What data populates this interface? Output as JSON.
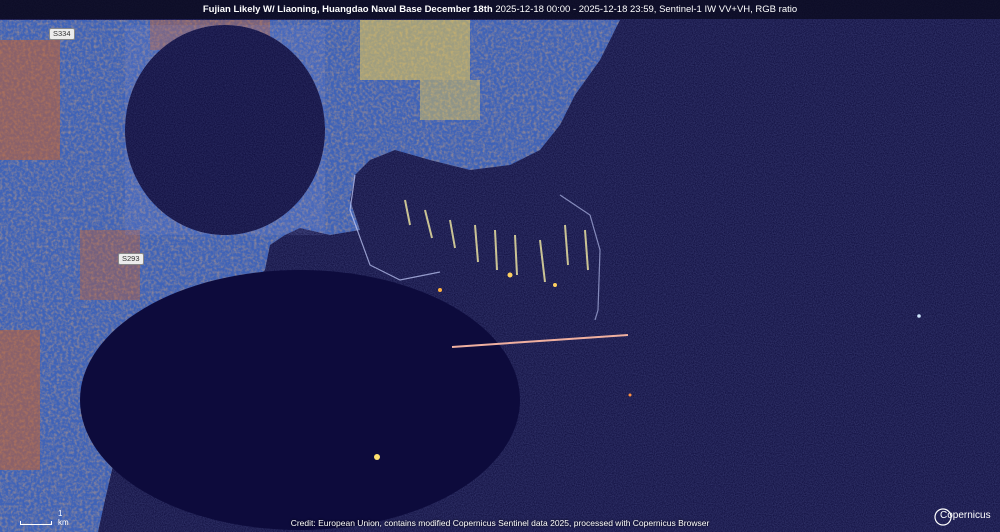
{
  "title": {
    "bold": "Fujian Likely W/ Liaoning, Huangdao Naval Base December 18th",
    "details": "2025-12-18 00:00 - 2025-12-18 23:59, Sentinel-1 IW VV+VH, RGB ratio"
  },
  "map": {
    "road_labels": [
      "S334",
      "S293"
    ],
    "colors": {
      "water": "#0c0a3a",
      "land_blue": "#4a70c8",
      "land_orange": "#d8702a",
      "land_yellow": "#f0d050"
    }
  },
  "footer": {
    "credit": "Credit: European Union, contains modified Copernicus Sentinel data 2025, processed with Copernicus Browser",
    "scale_label": "1 km",
    "logo_text": "Copernicus"
  }
}
